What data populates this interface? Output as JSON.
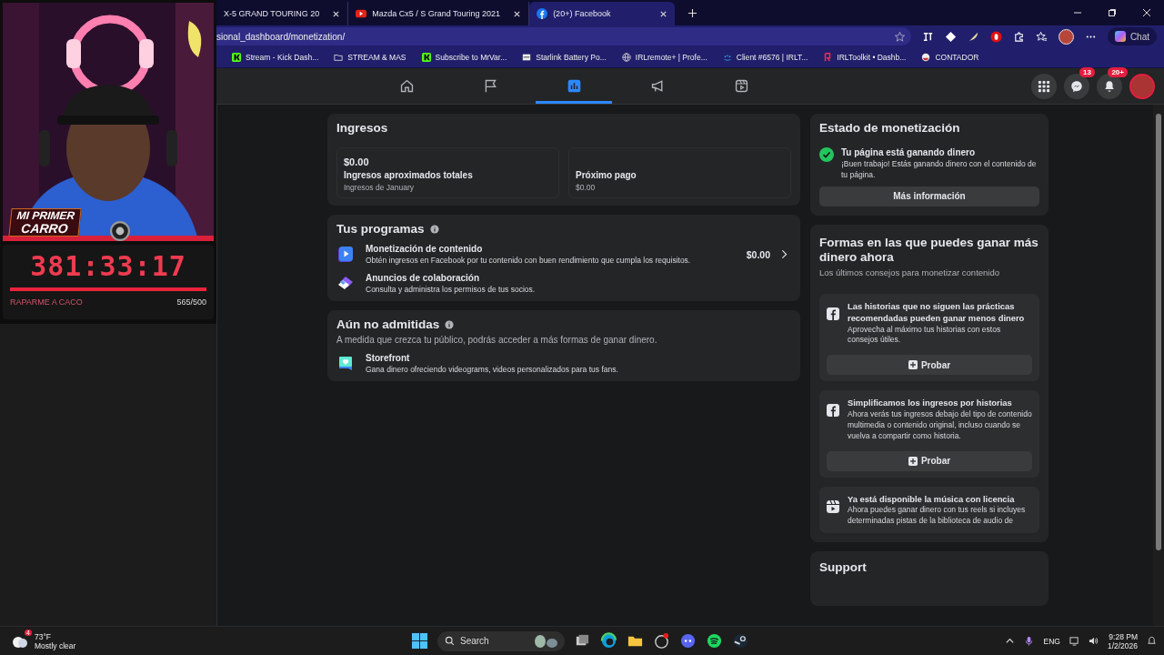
{
  "stream_overlay": {
    "caption_lines": [
      "MI PRIMER",
      "CARRO"
    ],
    "timer": "381:33:17",
    "goal_label": "RAPARME A CACO",
    "goal_count": "565/500",
    "level": 1
  },
  "browser": {
    "tabs": [
      {
        "title": "X-5 GRAND TOURING 20",
        "kind": "plain",
        "selected": false
      },
      {
        "title": "Mazda Cx5 / S Grand Touring 2021",
        "kind": "video",
        "selected": false
      },
      {
        "title": "(20+) Facebook",
        "kind": "social",
        "selected": true
      }
    ],
    "address": "sional_dashboard/monetization/",
    "chat_label": "Chat",
    "bookmarks": [
      {
        "label": "Stream - Kick Dash...",
        "kind": "k"
      },
      {
        "label": "STREAM & MAS",
        "kind": "folder"
      },
      {
        "label": "Subscribe to MrVar...",
        "kind": "k"
      },
      {
        "label": "Starlink Battery Po...",
        "kind": "page"
      },
      {
        "label": "IRLremote+ | Profe...",
        "kind": "globe"
      },
      {
        "label": "Client #6576 | IRLT...",
        "kind": "dots"
      },
      {
        "label": "IRLToolkit • Dashb...",
        "kind": "r"
      },
      {
        "label": "CONTADOR",
        "kind": "ship"
      }
    ]
  },
  "fb_nav": {
    "tabs": [
      {
        "kind": "home",
        "selected": false
      },
      {
        "kind": "flag",
        "selected": false
      },
      {
        "kind": "chart",
        "selected": true
      },
      {
        "kind": "megaphone",
        "selected": false
      },
      {
        "kind": "reels",
        "selected": false
      }
    ],
    "messenger_badge": "13",
    "notifications_badge": "20+"
  },
  "ingresos": {
    "title": "Ingresos",
    "cards": [
      {
        "amount": "$0.00",
        "label": "Ingresos aproximados totales",
        "sub": "Ingresos de January"
      },
      {
        "label": "Próximo pago",
        "sub": "$0.00"
      }
    ]
  },
  "programas": {
    "title": "Tus programas",
    "items": [
      {
        "kind": "play",
        "title": "Monetización de contenido",
        "desc": "Obtén ingresos en Facebook por tu contenido con buen rendimiento que cumpla los requisitos.",
        "amount": "$0.00"
      },
      {
        "kind": "collab",
        "title": "Anuncios de colaboración",
        "desc": "Consulta y administra los permisos de tus socios."
      }
    ]
  },
  "no_admitidas": {
    "title": "Aún no admitidas",
    "subtitle": "A medida que crezca tu público, podrás acceder a más formas de ganar dinero.",
    "items": [
      {
        "kind": "store",
        "title": "Storefront",
        "desc": "Gana dinero ofreciendo videograms, videos personalizados para tus fans."
      }
    ]
  },
  "estado": {
    "title": "Estado de monetización",
    "status": "Tu página está ganando dinero",
    "detail": "¡Buen trabajo! Estás ganando dinero con el contenido de tu página.",
    "button": "Más información"
  },
  "formas": {
    "title": "Formas en las que puedes ganar más dinero ahora",
    "subtitle": "Los últimos consejos para monetizar contenido",
    "tips": [
      {
        "kind": "social",
        "title": "Las historias que no siguen las prácticas recomendadas pueden ganar menos dinero",
        "desc": "Aprovecha al máximo tus historias con estos consejos útiles.",
        "button": "Probar"
      },
      {
        "kind": "social",
        "title": "Simplificamos los ingresos por historias",
        "desc": "Ahora verás tus ingresos debajo del tipo de contenido multimedia o contenido original, incluso cuando se vuelva a compartir como historia.",
        "button": "Probar"
      },
      {
        "kind": "reels",
        "title": "Ya está disponible la música con licencia",
        "desc": "Ahora puedes ganar dinero con tus reels si incluyes determinadas pistas de la biblioteca de audio de"
      }
    ]
  },
  "support": {
    "title": "Support"
  },
  "taskbar": {
    "weather_badge": "4",
    "temperature": "73°F",
    "weather": "Mostly clear",
    "search": "Search",
    "language": "ENG",
    "time": "9:28 PM",
    "date": "1/2/2026"
  }
}
